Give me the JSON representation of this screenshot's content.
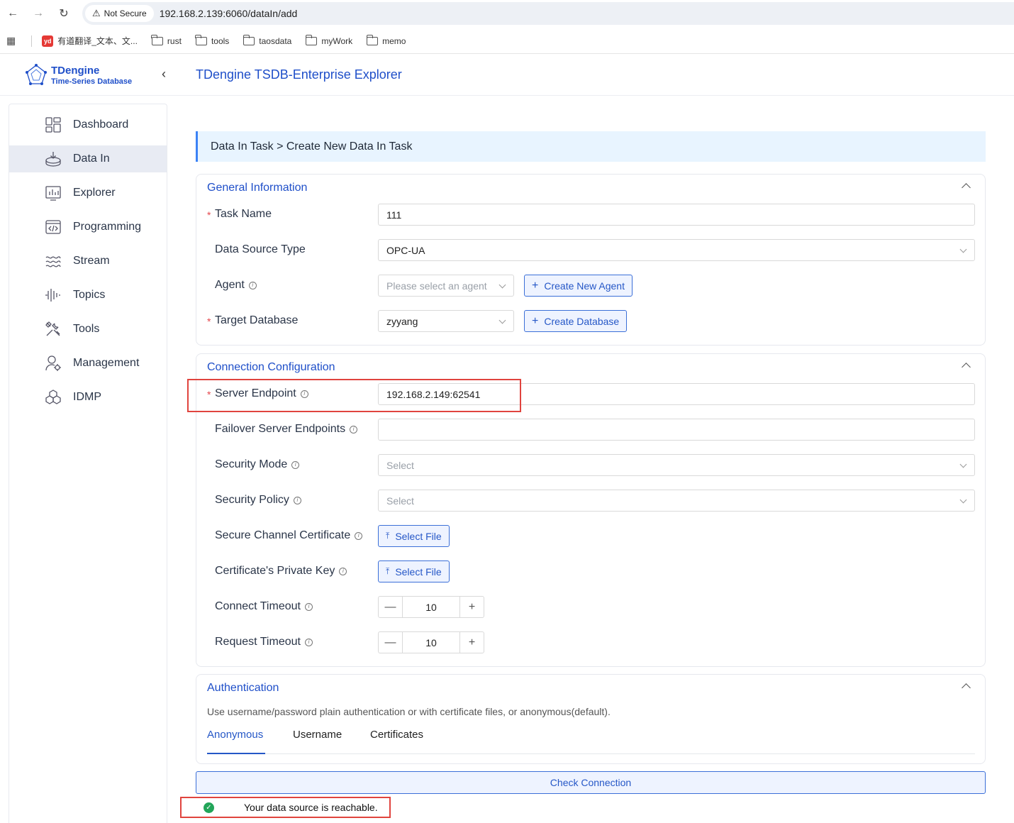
{
  "browser": {
    "security_label": "Not Secure",
    "url": "192.168.2.139:6060/dataIn/add",
    "bookmarks": [
      {
        "label": "有道翻译_文本、文...",
        "icon": "youdao-icon"
      },
      {
        "label": "rust",
        "icon": "folder-icon"
      },
      {
        "label": "tools",
        "icon": "folder-icon"
      },
      {
        "label": "taosdata",
        "icon": "folder-icon"
      },
      {
        "label": "myWork",
        "icon": "folder-icon"
      },
      {
        "label": "memo",
        "icon": "folder-icon"
      }
    ]
  },
  "header": {
    "logo_name": "TDengine",
    "logo_sub": "Time-Series Database",
    "title": "TDengine TSDB-Enterprise Explorer"
  },
  "sidebar": {
    "items": [
      {
        "label": "Dashboard",
        "icon": "dashboard-icon"
      },
      {
        "label": "Data In",
        "icon": "data-in-icon",
        "active": true
      },
      {
        "label": "Explorer",
        "icon": "explorer-icon"
      },
      {
        "label": "Programming",
        "icon": "programming-icon"
      },
      {
        "label": "Stream",
        "icon": "stream-icon"
      },
      {
        "label": "Topics",
        "icon": "topics-icon"
      },
      {
        "label": "Tools",
        "icon": "tools-icon"
      },
      {
        "label": "Management",
        "icon": "management-icon"
      },
      {
        "label": "IDMP",
        "icon": "idmp-icon"
      }
    ]
  },
  "breadcrumb": "Data In Task > Create New Data In Task",
  "general": {
    "title": "General Information",
    "task_name_label": "Task Name",
    "task_name_value": "111",
    "source_type_label": "Data Source Type",
    "source_type_value": "OPC-UA",
    "agent_label": "Agent",
    "agent_placeholder": "Please select an agent",
    "create_agent_label": "Create New Agent",
    "target_db_label": "Target Database",
    "target_db_value": "zyyang",
    "create_db_label": "Create Database"
  },
  "connection": {
    "title": "Connection Configuration",
    "endpoint_label": "Server Endpoint",
    "endpoint_value": "192.168.2.149:62541",
    "failover_label": "Failover Server Endpoints",
    "failover_value": "",
    "security_mode_label": "Security Mode",
    "security_mode_placeholder": "Select",
    "security_policy_label": "Security Policy",
    "security_policy_placeholder": "Select",
    "secure_cert_label": "Secure Channel Certificate",
    "private_key_label": "Certificate's Private Key",
    "select_file_label": "Select File",
    "connect_timeout_label": "Connect Timeout",
    "connect_timeout_value": "10",
    "request_timeout_label": "Request Timeout",
    "request_timeout_value": "10"
  },
  "auth": {
    "title": "Authentication",
    "description": "Use username/password plain authentication or with certificate files, or anonymous(default).",
    "tabs": [
      "Anonymous",
      "Username",
      "Certificates"
    ],
    "active_tab": "Anonymous"
  },
  "check_connection_label": "Check Connection",
  "reachable_message": "Your data source is reachable.",
  "colors": {
    "accent": "#2557c7",
    "success": "#22a559",
    "highlight_box": "#e0443e"
  }
}
